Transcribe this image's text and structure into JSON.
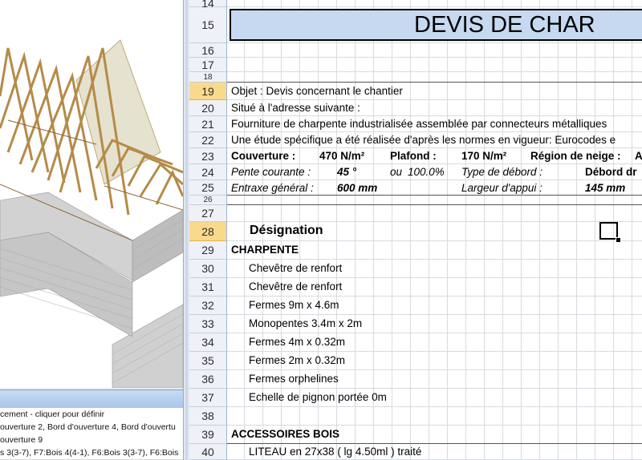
{
  "left_panel": {
    "list_items": [
      "cement - cliquer pour définir",
      "ouverture 2, Bord d'ouverture 4, Bord d'ouvertu",
      "ouverture 9",
      "s 3(3-7), F7:Bois 4(4-1), F6:Bois 3(3-7), F6:Bois"
    ]
  },
  "sheet": {
    "title": "DEVIS DE CHAR",
    "rows": {
      "r14": "14",
      "r15": "15",
      "r16": "16",
      "r17": "17",
      "r18": "18",
      "r19": "19",
      "r20": "20",
      "r21": "21",
      "r22": "22",
      "r23": "23",
      "r24": "24",
      "r25": "25",
      "r26": "26",
      "r27": "27",
      "r28": "28",
      "r29": "29",
      "r30": "30",
      "r31": "31",
      "r32": "32",
      "r33": "33",
      "r34": "34",
      "r35": "35",
      "r36": "36",
      "r37": "37",
      "r38": "38",
      "r39": "39",
      "r40": "40"
    },
    "objet": "Objet : Devis concernant le chantier",
    "adresse": "Situé à l'adresse suivante :",
    "fourniture": "Fourniture de charpente industrialisée assemblée par connecteurs métalliques",
    "etude": "Une étude spécifique a été réalisée d'après les normes en vigueur: Eurocodes e",
    "couverture_label": "Couverture :",
    "couverture_value": "470 N/m²",
    "plafond_label": "Plafond :",
    "plafond_value": "170 N/m²",
    "neige_label": "Région de neige :",
    "neige_value": "A",
    "pente_label": "Pente courante :",
    "pente_value": "45 °",
    "pente_ou": "ou",
    "pente_pct": "100.0%",
    "debord_type_label": "Type de débord :",
    "debord_value": "Débord dr",
    "entraxe_label": "Entraxe général :",
    "entraxe_value": "600 mm",
    "appui_label": "Largeur d'appui :",
    "appui_value": "145 mm",
    "designation": "Désignation",
    "charpente": "CHARPENTE",
    "items": [
      "Chevêtre de renfort",
      "Chevêtre de renfort",
      "Fermes 9m x 4.6m",
      "Monopentes 3.4m x 2m",
      "Fermes 4m x 0.32m",
      "Fermes 2m x 0.32m",
      "Fermes orphelines",
      "Echelle de pignon portée 0m"
    ],
    "accessoires": "ACCESSOIRES BOIS",
    "liteau": "LITEAU en 27x38 ( lg 4.50ml ) traité"
  },
  "colors": {
    "title_fill": "#c6d9f1",
    "selected_row_header": "#f9d98c",
    "timber": "#c8a265",
    "brick": "#c9c9c9"
  }
}
